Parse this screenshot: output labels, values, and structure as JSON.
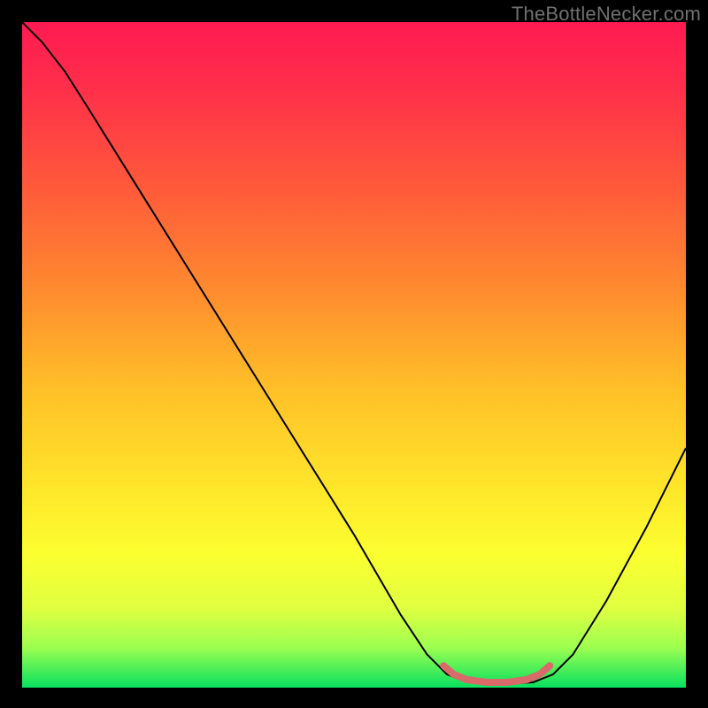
{
  "watermark": "TheBottleNecker.com",
  "chart_data": {
    "type": "line",
    "title": "",
    "xlabel": "",
    "ylabel": "",
    "xlim": [
      0,
      100
    ],
    "ylim": [
      0,
      100
    ],
    "gradient_stops": [
      {
        "offset": 0.0,
        "color": "#ff1a52"
      },
      {
        "offset": 0.1,
        "color": "#ff2f4a"
      },
      {
        "offset": 0.25,
        "color": "#ff5a3a"
      },
      {
        "offset": 0.4,
        "color": "#ff8a2f"
      },
      {
        "offset": 0.55,
        "color": "#ffbf28"
      },
      {
        "offset": 0.7,
        "color": "#ffe62a"
      },
      {
        "offset": 0.8,
        "color": "#fbff30"
      },
      {
        "offset": 0.88,
        "color": "#e0ff40"
      },
      {
        "offset": 0.94,
        "color": "#9cff50"
      },
      {
        "offset": 1.0,
        "color": "#08e060"
      }
    ],
    "series": [
      {
        "name": "bottleneck-curve",
        "stroke": "#000000",
        "stroke_width": 2,
        "points": [
          [
            0.0,
            100.0
          ],
          [
            3.0,
            97.0
          ],
          [
            6.5,
            92.5
          ],
          [
            10.0,
            87.0
          ],
          [
            20.0,
            71.0
          ],
          [
            30.0,
            55.0
          ],
          [
            40.0,
            39.0
          ],
          [
            50.0,
            23.0
          ],
          [
            57.0,
            11.0
          ],
          [
            61.0,
            5.0
          ],
          [
            64.0,
            2.0
          ],
          [
            67.0,
            0.8
          ],
          [
            72.0,
            0.5
          ],
          [
            77.0,
            0.8
          ],
          [
            80.0,
            2.0
          ],
          [
            83.0,
            5.0
          ],
          [
            88.0,
            13.0
          ],
          [
            94.0,
            24.0
          ],
          [
            100.0,
            36.0
          ]
        ]
      },
      {
        "name": "minimum-band",
        "stroke": "#d96a6a",
        "stroke_width": 8,
        "linecap": "round",
        "points": [
          [
            63.5,
            3.3
          ],
          [
            65.0,
            2.0
          ],
          [
            67.0,
            1.2
          ],
          [
            70.0,
            0.8
          ],
          [
            73.0,
            0.8
          ],
          [
            76.0,
            1.2
          ],
          [
            78.0,
            2.0
          ],
          [
            79.5,
            3.3
          ]
        ]
      }
    ]
  }
}
